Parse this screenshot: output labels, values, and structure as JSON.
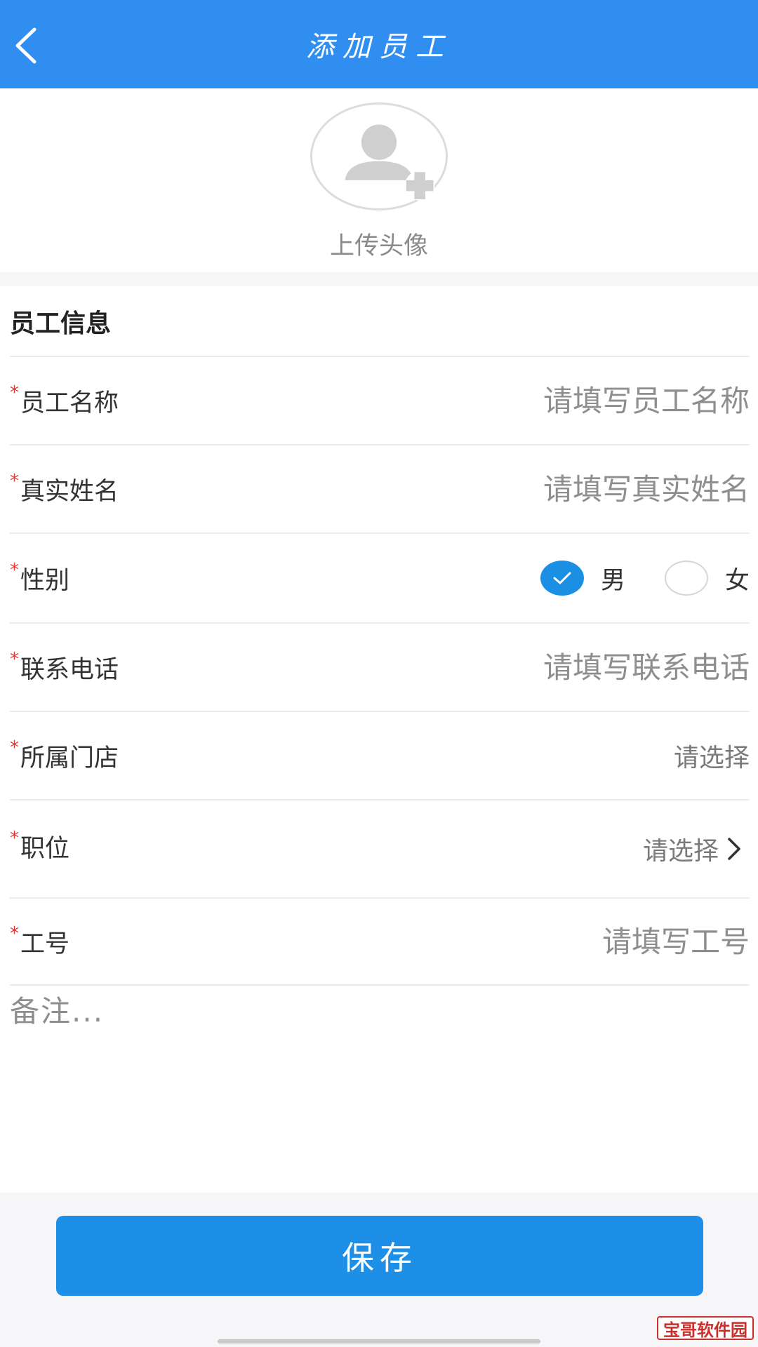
{
  "header": {
    "title": "添加员工",
    "back_icon": "chevron-left-icon"
  },
  "avatar": {
    "label": "上传头像",
    "icon": "user-icon"
  },
  "section_title": "员工信息",
  "required_mark": "*",
  "fields": {
    "employee_name": {
      "label": "员工名称",
      "placeholder": "请填写员工名称",
      "value": ""
    },
    "real_name": {
      "label": "真实姓名",
      "placeholder": "请填写真实姓名",
      "value": ""
    },
    "gender": {
      "label": "性别",
      "options": [
        "男",
        "女"
      ],
      "selected": "男"
    },
    "phone": {
      "label": "联系电话",
      "placeholder": "请填写联系电话",
      "value": ""
    },
    "store": {
      "label": "所属门店",
      "value": "请选择"
    },
    "position": {
      "label": "职位",
      "value": "请选择",
      "icon": "chevron-right-icon"
    },
    "employee_id": {
      "label": "工号",
      "placeholder": "请填写工号",
      "value": ""
    }
  },
  "remark": {
    "placeholder": "备注...",
    "value": ""
  },
  "save_label": "保存",
  "watermark": "宝哥软件园",
  "colors": {
    "header_bg": "#2f8ef0",
    "primary": "#1d8fe6",
    "required": "#e23b3b"
  }
}
